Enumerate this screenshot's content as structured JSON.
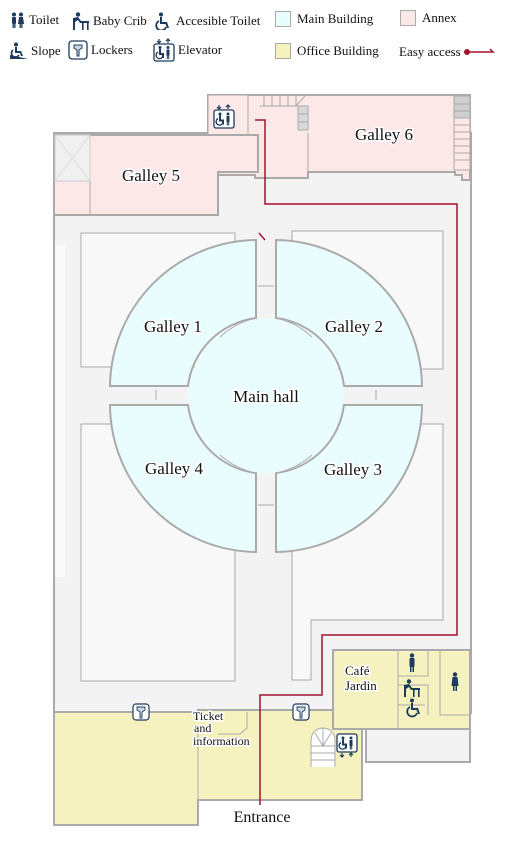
{
  "legend": {
    "toilet": "Toilet",
    "baby_crib": "Baby Crib",
    "accessible_toilet": "Accesible Toilet",
    "slope": "Slope",
    "lockers": "Lockers",
    "elevator": "Elevator",
    "main_building": "Main Building",
    "annex": "Annex",
    "office_building": "Office Building",
    "easy_access": "Easy access"
  },
  "colors": {
    "main_building": "#eafdfe",
    "annex": "#fde8e8",
    "office_building": "#f6f2bf",
    "corridor": "#f3f3f3",
    "wall": "#aaaaaa",
    "route": "#a3122f",
    "icon": "#1d3b5c"
  },
  "rooms": {
    "galley1": "Galley 1",
    "galley2": "Galley 2",
    "galley3": "Galley 3",
    "galley4": "Galley 4",
    "galley5": "Galley 5",
    "galley6": "Galley 6",
    "main_hall": "Main hall",
    "cafe_line1": "Café",
    "cafe_line2": "Jardin",
    "ticket_line1": "Ticket",
    "ticket_line2": "and",
    "ticket_line3": "information",
    "entrance": "Entrance"
  },
  "icons": {
    "toilet": "toilet-icon",
    "baby_crib": "baby-crib-icon",
    "accessible_toilet": "accessible-toilet-icon",
    "slope": "slope-icon",
    "lockers": "lockers-icon",
    "elevator": "elevator-icon"
  }
}
